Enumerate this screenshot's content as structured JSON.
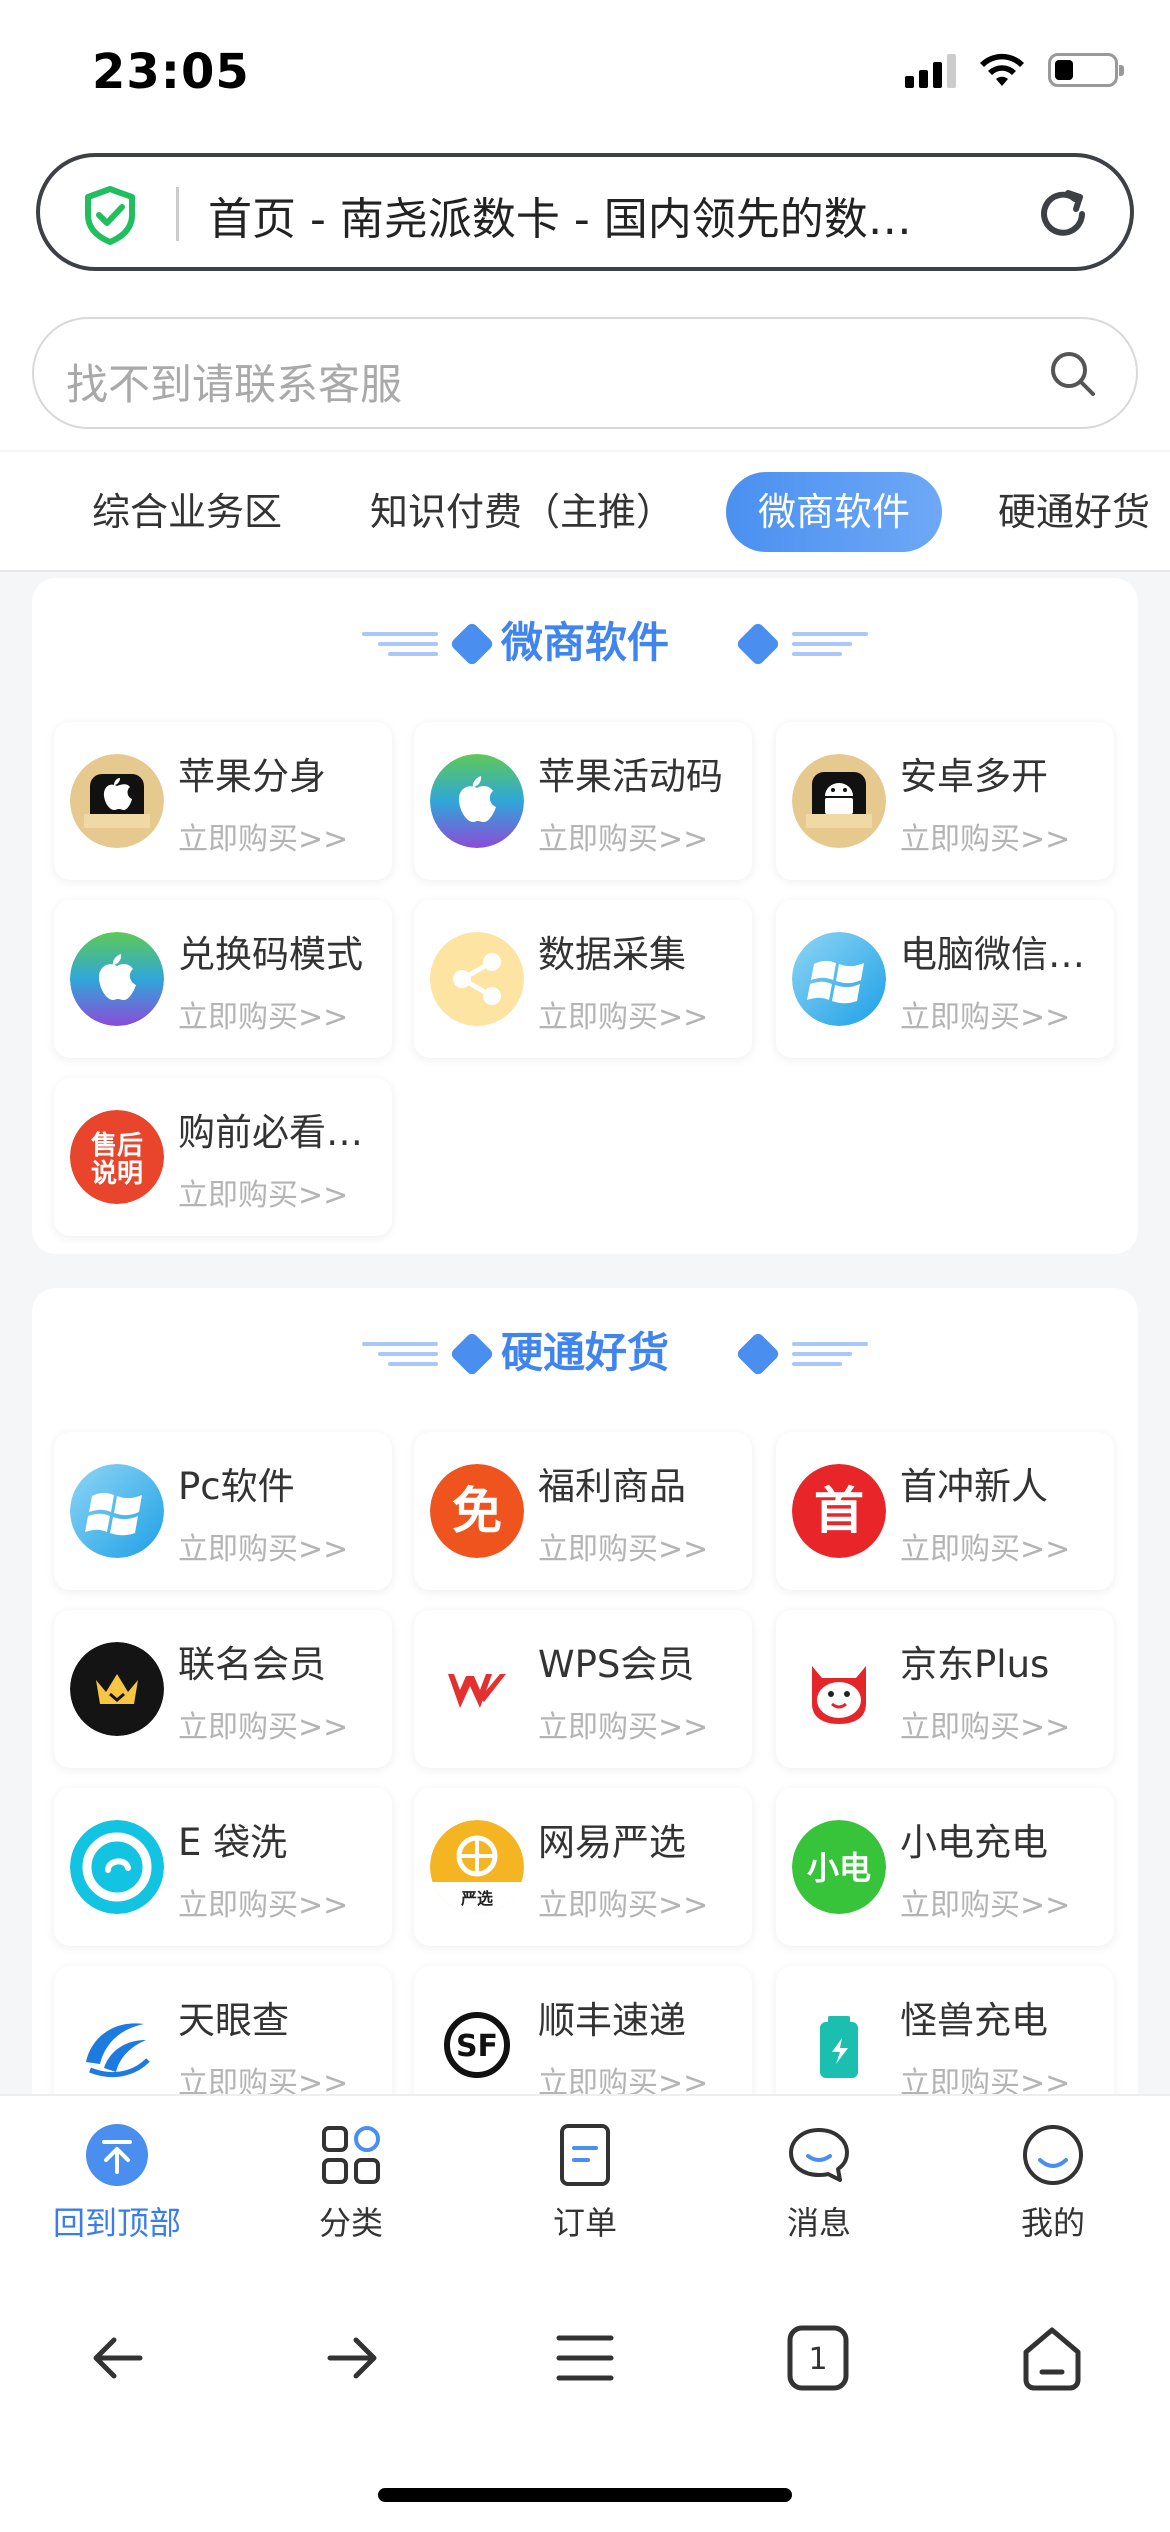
{
  "status": {
    "time": "23:05"
  },
  "browser": {
    "url_title": "首页 - 南尧派数卡 - 国内领先的数…"
  },
  "search": {
    "placeholder": "找不到请联系客服"
  },
  "tabs": [
    {
      "label": "综合业务区"
    },
    {
      "label": "知识付费（主推）"
    },
    {
      "label": "微商软件"
    },
    {
      "label": "硬通好货"
    }
  ],
  "sections": [
    {
      "title": "微商软件",
      "items": [
        {
          "title": "苹果分身",
          "sub": "立即购买>>",
          "icon": "apple-clone-icon"
        },
        {
          "title": "苹果活动码",
          "sub": "立即购买>>",
          "icon": "apple-icon"
        },
        {
          "title": "安卓多开",
          "sub": "立即购买>>",
          "icon": "android-icon"
        },
        {
          "title": "兑换码模式",
          "sub": "立即购买>>",
          "icon": "apple-icon"
        },
        {
          "title": "数据采集",
          "sub": "立即购买>>",
          "icon": "share-icon"
        },
        {
          "title": "电脑微信…",
          "sub": "立即购买>>",
          "icon": "windows-icon"
        },
        {
          "title": "购前必看…",
          "sub": "立即购买>>",
          "icon": "after-sales-icon",
          "icon_text": "售后说明"
        }
      ]
    },
    {
      "title": "硬通好货",
      "items": [
        {
          "title": "Pc软件",
          "sub": "立即购买>>",
          "icon": "windows-icon"
        },
        {
          "title": "福利商品",
          "sub": "立即购买>>",
          "icon": "free-icon",
          "icon_text": "免"
        },
        {
          "title": "首冲新人",
          "sub": "立即购买>>",
          "icon": "first-icon",
          "icon_text": "首"
        },
        {
          "title": "联名会员",
          "sub": "立即购买>>",
          "icon": "crown-icon"
        },
        {
          "title": "WPS会员",
          "sub": "立即购买>>",
          "icon": "wps-icon"
        },
        {
          "title": "京东Plus",
          "sub": "立即购买>>",
          "icon": "jd-icon"
        },
        {
          "title": "E 袋洗",
          "sub": "立即购买>>",
          "icon": "edaixi-icon"
        },
        {
          "title": "网易严选",
          "sub": "立即购买>>",
          "icon": "yanxuan-icon",
          "icon_text": "严选"
        },
        {
          "title": "小电充电",
          "sub": "立即购买>>",
          "icon": "xiaodian-icon",
          "icon_text": "小电"
        },
        {
          "title": "天眼查",
          "sub": "立即购买>>",
          "icon": "tianyancha-icon"
        },
        {
          "title": "顺丰速递",
          "sub": "立即购买>>",
          "icon": "sf-icon"
        },
        {
          "title": "怪兽充电",
          "sub": "立即购买>>",
          "icon": "battery-icon"
        }
      ]
    }
  ],
  "bottom_nav": [
    {
      "label": "回到顶部",
      "icon": "back-to-top-icon"
    },
    {
      "label": "分类",
      "icon": "category-icon"
    },
    {
      "label": "订单",
      "icon": "order-icon"
    },
    {
      "label": "消息",
      "icon": "message-icon"
    },
    {
      "label": "我的",
      "icon": "profile-icon"
    }
  ],
  "colors": {
    "accent": "#3f84ef",
    "tab_active": "#4a90f0",
    "sub_text": "#b4b4b4"
  }
}
